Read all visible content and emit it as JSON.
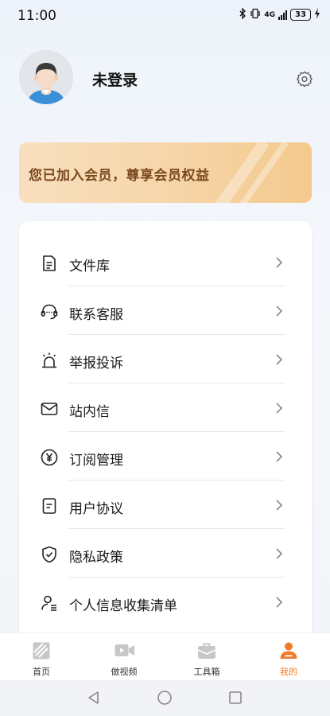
{
  "status_bar": {
    "time": "11:00",
    "network": "4G",
    "battery": "33"
  },
  "profile": {
    "username": "未登录"
  },
  "banner": {
    "text": "您已加入会员，尊享会员权益"
  },
  "menu": {
    "items": [
      {
        "label": "文件库",
        "icon": "document-icon"
      },
      {
        "label": "联系客服",
        "icon": "headset-icon"
      },
      {
        "label": "举报投诉",
        "icon": "alarm-light-icon"
      },
      {
        "label": "站内信",
        "icon": "envelope-icon"
      },
      {
        "label": "订阅管理",
        "icon": "yen-circle-icon"
      },
      {
        "label": "用户协议",
        "icon": "agreement-icon"
      },
      {
        "label": "隐私政策",
        "icon": "shield-check-icon"
      },
      {
        "label": "个人信息收集清单",
        "icon": "user-list-icon"
      }
    ]
  },
  "bottom_nav": {
    "items": [
      {
        "label": "首页",
        "icon": "home-icon"
      },
      {
        "label": "做视频",
        "icon": "video-icon"
      },
      {
        "label": "工具箱",
        "icon": "toolbox-icon"
      },
      {
        "label": "我的",
        "icon": "profile-icon",
        "active": true
      }
    ]
  },
  "colors": {
    "accent": "#f07a2a",
    "banner_text": "#7a4a1f",
    "banner_start": "#f8dfbf",
    "banner_end": "#f3c98d"
  }
}
